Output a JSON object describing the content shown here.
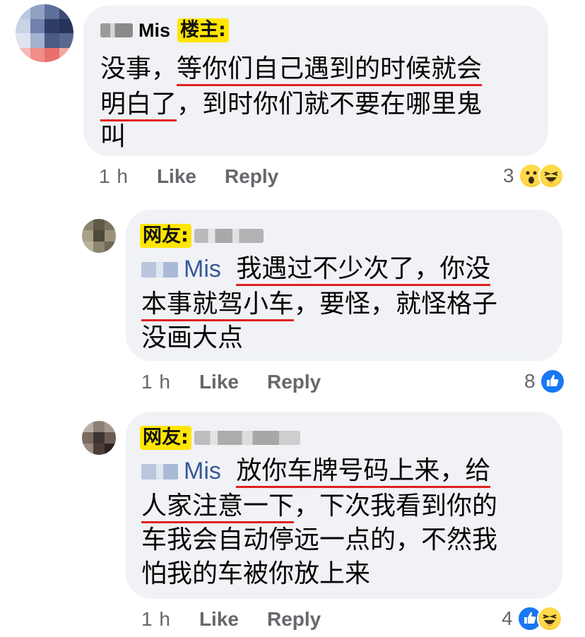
{
  "comments": [
    {
      "author": "Mis",
      "tag": "楼主:",
      "lines": [
        [
          {
            "t": "没事，"
          },
          {
            "t": "等你们自己遇到的时候就会",
            "u": true
          }
        ],
        [
          {
            "t": "明白了",
            "u": true
          },
          {
            "t": "，到时你们就不要在哪里鬼"
          }
        ],
        [
          {
            "t": "叫"
          }
        ]
      ],
      "time": "1 h",
      "like": "Like",
      "reply": "Reply",
      "reaction_count": "3",
      "reactions": [
        "wow-icon",
        "haha-icon"
      ]
    },
    {
      "tag": "网友:",
      "mention": "Mis",
      "lines": [
        [
          {
            "t": "我遇过不少次了，你没",
            "u": true
          }
        ],
        [
          {
            "t": "本事就驾小车",
            "u": true
          },
          {
            "t": "，要怪，就怪格子"
          }
        ],
        [
          {
            "t": "没画大点"
          }
        ]
      ],
      "time": "1 h",
      "like": "Like",
      "reply": "Reply",
      "reaction_count": "8",
      "reactions": [
        "like-icon"
      ]
    },
    {
      "tag": "网友:",
      "mention": "Mis",
      "lines": [
        [
          {
            "t": "放你车牌号码上来，给",
            "u": true
          }
        ],
        [
          {
            "t": "人家注意一下",
            "u": true
          },
          {
            "t": "，下次我看到你的"
          }
        ],
        [
          {
            "t": "车我会自动停远一点的，不然我"
          }
        ],
        [
          {
            "t": "怕我的车被你放上来"
          }
        ]
      ],
      "time": "1 h",
      "like": "Like",
      "reply": "Reply",
      "reaction_count": "4",
      "reactions": [
        "like-icon",
        "haha-icon"
      ]
    }
  ],
  "colors": {
    "bubble": "#f0f2f5",
    "underline": "#e02020",
    "tag_bg": "#ffe500",
    "mention": "#385898",
    "meta": "#65676b"
  }
}
